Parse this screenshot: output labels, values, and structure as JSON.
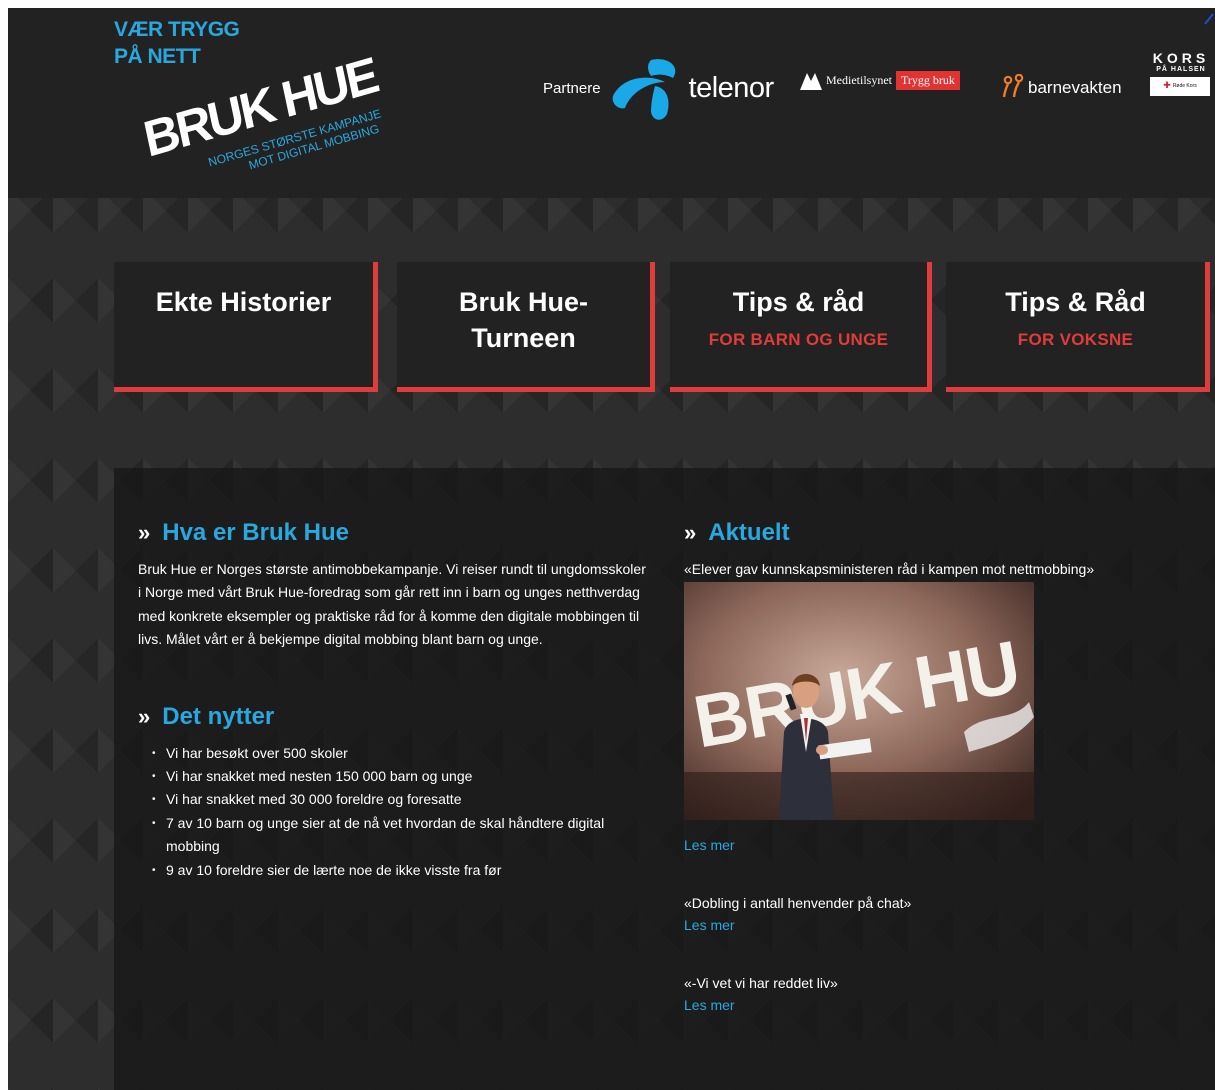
{
  "header": {
    "tagline_line1": "VÆR TRYGG",
    "tagline_line2": "PÅ NETT",
    "logo_text": "BRUK HUE",
    "logo_sub_line1": "NORGES STØRSTE KAMPANJE",
    "logo_sub_line2": "MOT DIGITAL MOBBING",
    "partners_label": "Partnere",
    "partners": {
      "telenor": "telenor",
      "medietilsynet": "Medietilsynet",
      "trygg_bruk": "Trygg bruk",
      "barnevakten": "barnevakten",
      "kors_big": "KORS",
      "kors_small": "PÅ HALSEN",
      "rode_kors": "Røde Kors"
    }
  },
  "nav": [
    {
      "title": "Ekte Historier",
      "sub": ""
    },
    {
      "title": "Bruk Hue-Turneen",
      "sub": ""
    },
    {
      "title": "Tips & råd",
      "sub": "FOR BARN OG UNGE"
    },
    {
      "title": "Tips & Råd",
      "sub": "FOR VOKSNE"
    }
  ],
  "about": {
    "raquo": "»",
    "title": "Hva er Bruk Hue",
    "text": "Bruk Hue er Norges største antimobbekampanje. Vi reiser rundt til ungdomsskoler i Norge med vårt Bruk Hue-foredrag som går rett inn i barn og unges netthverdag med konkrete eksempler og praktiske råd for å komme den digitale mobbingen til livs. Målet vårt er å bekjempe digital mobbing blant barn og unge."
  },
  "stats": {
    "raquo": "»",
    "title": "Det nytter",
    "items": [
      "Vi har besøkt over 500 skoler",
      "Vi har snakket med nesten 150 000 barn og unge",
      "Vi har snakket med 30 000 foreldre og foresatte",
      "7 av 10 barn og unge sier at de nå vet hvordan de skal håndtere digital mobbing",
      "9 av 10 foreldre sier de lærte noe de ikke visste fra før"
    ]
  },
  "news": {
    "raquo": "»",
    "title": "Aktuelt",
    "read_more": "Les mer",
    "image_logo_text": "BRUK HU",
    "items": [
      {
        "headline": "«Elever gav kunnskapsministeren råd i kampen mot nettmobbing»"
      },
      {
        "headline": "«Dobling i antall henvender på chat»"
      },
      {
        "headline": "«-Vi vet vi har reddet liv»"
      }
    ]
  },
  "colors": {
    "accent_blue": "#29a8e0",
    "accent_red": "#e03c3c",
    "header_bg": "#222222",
    "page_bg": "#2d2d2d"
  }
}
